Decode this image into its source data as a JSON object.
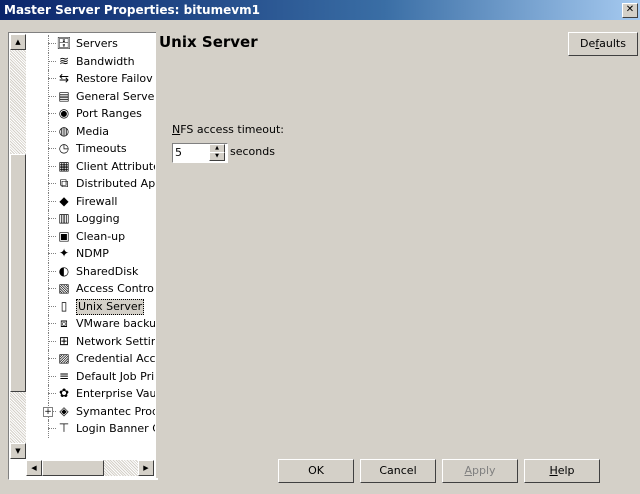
{
  "window": {
    "title": "Master Server Properties: bitumevm1",
    "close_glyph": "✕"
  },
  "tree": {
    "items": [
      {
        "label": "Servers",
        "icon": "servers-icon",
        "glyph": "🗄"
      },
      {
        "label": "Bandwidth",
        "icon": "bandwidth-icon",
        "glyph": "≋"
      },
      {
        "label": "Restore Failov",
        "icon": "restore-failover-icon",
        "glyph": "⇆"
      },
      {
        "label": "General Server",
        "icon": "general-server-icon",
        "glyph": "▤"
      },
      {
        "label": "Port Ranges",
        "icon": "port-ranges-icon",
        "glyph": "◉"
      },
      {
        "label": "Media",
        "icon": "media-icon",
        "glyph": "◍"
      },
      {
        "label": "Timeouts",
        "icon": "timeouts-icon",
        "glyph": "◷"
      },
      {
        "label": "Client Attribute",
        "icon": "client-attributes-icon",
        "glyph": "▦"
      },
      {
        "label": "Distributed App",
        "icon": "distributed-app-icon",
        "glyph": "⧉"
      },
      {
        "label": "Firewall",
        "icon": "firewall-icon",
        "glyph": "◆"
      },
      {
        "label": "Logging",
        "icon": "logging-icon",
        "glyph": "▥"
      },
      {
        "label": "Clean-up",
        "icon": "clean-up-icon",
        "glyph": "▣"
      },
      {
        "label": "NDMP",
        "icon": "ndmp-icon",
        "glyph": "✦"
      },
      {
        "label": "SharedDisk",
        "icon": "shared-disk-icon",
        "glyph": "◐"
      },
      {
        "label": "Access Contro",
        "icon": "access-control-icon",
        "glyph": "▧"
      },
      {
        "label": "Unix Server",
        "icon": "unix-server-icon",
        "glyph": "▯"
      },
      {
        "label": "VMware backu",
        "icon": "vmware-backup-icon",
        "glyph": "⧈"
      },
      {
        "label": "Network Settin",
        "icon": "network-settings-icon",
        "glyph": "⊞"
      },
      {
        "label": "Credential Acc",
        "icon": "credential-access-icon",
        "glyph": "▨"
      },
      {
        "label": "Default Job Pri",
        "icon": "default-job-priority-icon",
        "glyph": "≡"
      },
      {
        "label": "Enterprise Vau",
        "icon": "enterprise-vault-icon",
        "glyph": "✿"
      },
      {
        "label": "Symantec Prod",
        "icon": "symantec-products-icon",
        "glyph": "◈",
        "expander": "+"
      },
      {
        "label": "Login Banner C",
        "icon": "login-banner-icon",
        "glyph": "⊤"
      }
    ],
    "selected_index": 15,
    "scroll_up_glyph": "▲",
    "scroll_down_glyph": "▼",
    "scroll_left_glyph": "◀",
    "scroll_right_glyph": "▶"
  },
  "content": {
    "title": "Unix Server",
    "defaults_pre": "De",
    "defaults_u": "f",
    "defaults_post": "aults",
    "nfs_label_u": "N",
    "nfs_label_rest": "FS access timeout:",
    "nfs_timeout_value": "5",
    "spin_up_glyph": "▲",
    "spin_down_glyph": "▼",
    "seconds_label": "seconds"
  },
  "buttons": {
    "ok": "OK",
    "cancel": "Cancel",
    "apply_u": "A",
    "apply_rest": "pply",
    "help_u": "H",
    "help_rest": "elp"
  }
}
